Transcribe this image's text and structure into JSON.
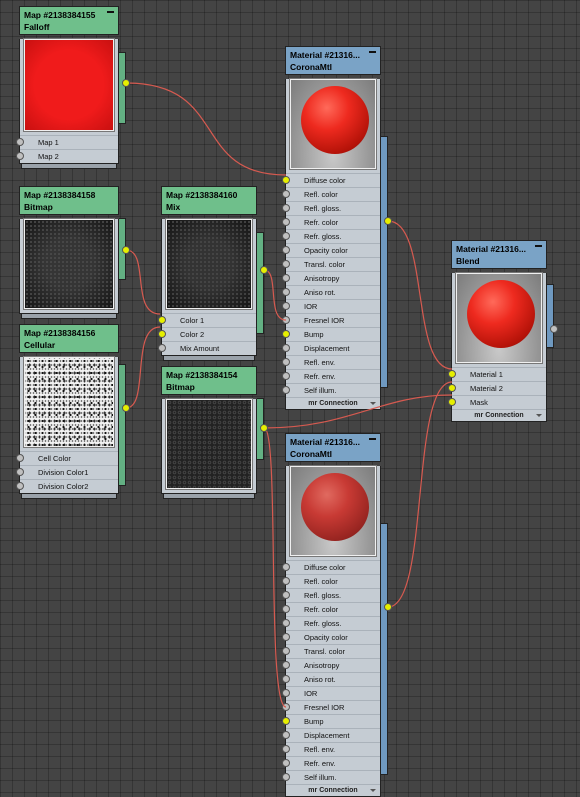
{
  "colors": {
    "wire": "#d65a50",
    "socket_on": "#e6ef00",
    "map_header": "#6fbf8b",
    "material_header": "#7aa3c6"
  },
  "nodes": {
    "falloff": {
      "title": "Map #2138384155",
      "type": "Falloff",
      "slots": [
        "Map 1",
        "Map 2"
      ]
    },
    "bitmap_158": {
      "title": "Map #2138384158",
      "type": "Bitmap"
    },
    "mix": {
      "title": "Map #2138384160",
      "type": "Mix",
      "slots": [
        "Color 1",
        "Color 2",
        "Mix Amount"
      ]
    },
    "cellular": {
      "title": "Map #2138384156",
      "type": "Cellular",
      "slots": [
        "Cell Color",
        "Division Color1",
        "Division Color2"
      ]
    },
    "bitmap_154": {
      "title": "Map #2138384154",
      "type": "Bitmap"
    },
    "corona_1": {
      "title": "Material #21316...",
      "type": "CoronaMtl",
      "footer": "mr Connection"
    },
    "corona_2": {
      "title": "Material #21316...",
      "type": "CoronaMtl",
      "footer": "mr Connection"
    },
    "blend": {
      "title": "Material #21316...",
      "type": "Blend",
      "slots": [
        "Material 1",
        "Material 2",
        "Mask"
      ],
      "footer": "mr Connection"
    }
  },
  "corona_slots": [
    "Diffuse color",
    "Refl. color",
    "Refl. gloss.",
    "Refr. color",
    "Refr. gloss.",
    "Opacity color",
    "Transl. color",
    "Anisotropy",
    "Aniso rot.",
    "IOR",
    "Fresnel IOR",
    "Bump",
    "Displacement",
    "Refl. env.",
    "Refr. env.",
    "Self illum."
  ]
}
